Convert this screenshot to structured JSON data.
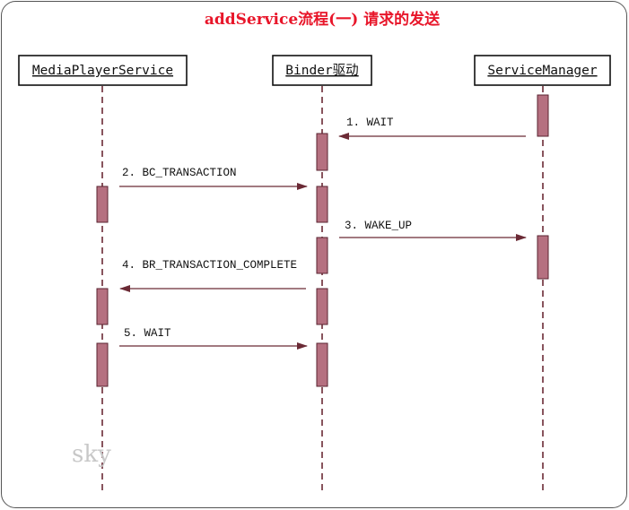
{
  "diagram": {
    "title": "addService流程(一) 请求的发送",
    "title_color": "#e8162a",
    "watermark": "sky",
    "line_color": "#6b2a35",
    "activation_color": "#b57080",
    "participants": [
      {
        "id": "mps",
        "label": "MediaPlayerService"
      },
      {
        "id": "binder",
        "label": "Binder驱动"
      },
      {
        "id": "sm",
        "label": "ServiceManager"
      }
    ],
    "messages": [
      {
        "label": "1.  WAIT",
        "from": "sm",
        "to": "binder"
      },
      {
        "label": "2.  BC_TRANSACTION",
        "from": "mps",
        "to": "binder"
      },
      {
        "label": "3.  WAKE_UP",
        "from": "binder",
        "to": "sm"
      },
      {
        "label": "4.  BR_TRANSACTION_COMPLETE",
        "from": "binder",
        "to": "mps"
      },
      {
        "label": "5.  WAIT",
        "from": "mps",
        "to": "binder"
      }
    ]
  }
}
